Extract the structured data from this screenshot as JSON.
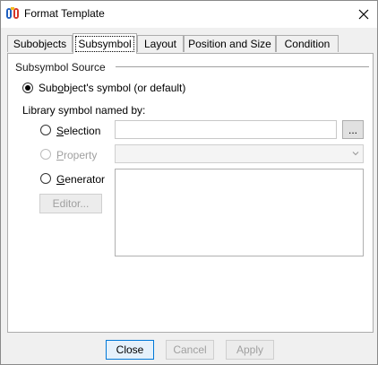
{
  "window": {
    "title": "Format Template",
    "icons": {
      "app": "app-logo-icon",
      "close": "close-icon"
    }
  },
  "tabs": [
    {
      "label": "Subobjects",
      "active": false
    },
    {
      "label": "Subsymbol",
      "active": true
    },
    {
      "label": "Layout",
      "active": false
    },
    {
      "label": "Position and Size",
      "active": false
    },
    {
      "label": "Condition",
      "active": false
    }
  ],
  "source": {
    "group_title": "Subsymbol Source",
    "option_default": {
      "pre": "Sub",
      "ul": "o",
      "post": "bject's symbol (or default)",
      "checked": true
    },
    "library_label": "Library symbol named by:",
    "option_selection": {
      "ul": "S",
      "post": "election",
      "value": ""
    },
    "browse_label": "...",
    "option_property": {
      "ul": "P",
      "post": "roperty",
      "value": "",
      "disabled": true
    },
    "option_generator": {
      "ul": "G",
      "post": "enerator",
      "value": ""
    },
    "editor_label": "Editor..."
  },
  "footer": {
    "close_label": "Close",
    "cancel_label": "Cancel",
    "apply_label": "Apply"
  }
}
